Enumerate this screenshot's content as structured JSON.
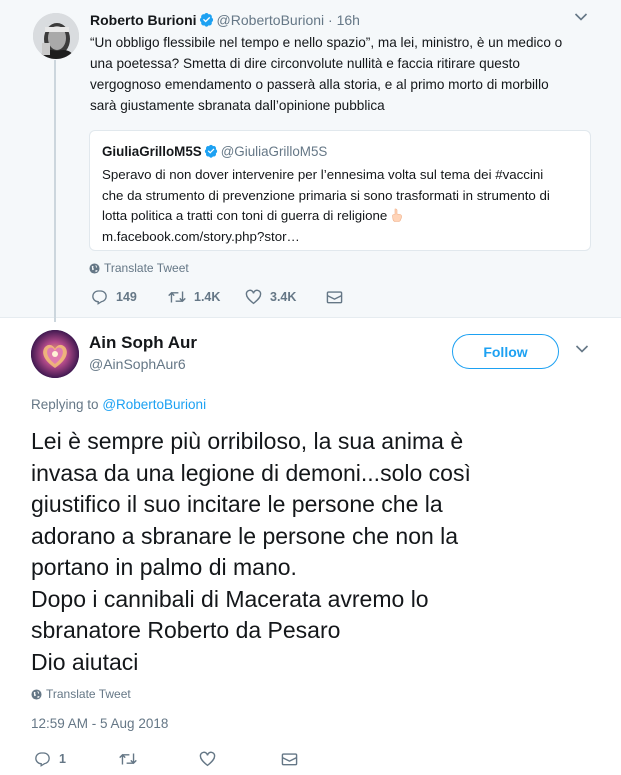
{
  "parent_tweet": {
    "author_name": "Roberto Burioni",
    "author_handle": "@RobertoBurioni",
    "time": "16h",
    "separator": "·",
    "text_lines": [
      "“Un obbligo flessibile nel tempo e nello spazio”, ma lei, ministro, è un medico o",
      "una poetessa? Smetta di dire circonvolute nullità e faccia ritirare questo",
      "vergognoso emendamento o passerà alla storia, e al primo morto di morbillo",
      "sarà giustamente sbranata dall’opinione pubblica"
    ],
    "quoted": {
      "author_name": "GiuliaGrilloM5S",
      "author_handle": "@GiuliaGrilloM5S",
      "text_lines": [
        "Speravo di non dover intervenire per l’ennesima volta sul tema dei #vaccini",
        "che da strumento di prevenzione primaria si sono trasformati in strumento di",
        "lotta politica a tratti con toni di guerra di religione",
        "m.facebook.com/story.php?stor…"
      ]
    },
    "translate_label": "Translate Tweet",
    "actions": {
      "reply_count": "149",
      "retweet_count": "1.4K",
      "like_count": "3.4K"
    }
  },
  "main_tweet": {
    "author_name": "Ain Soph Aur",
    "author_handle": "@AinSophAur6",
    "follow_label": "Follow",
    "replying_label": "Replying to",
    "replying_to": "@RobertoBurioni",
    "text_lines": [
      "Lei è sempre più orribiloso, la sua anima è",
      "invasa da una legione di demoni...solo così",
      "giustifico il suo incitare le persone che la",
      "adorano a sbranare le persone che non la",
      "portano in palmo di mano.",
      "Dopo i cannibali di Macerata avremo lo",
      "sbranatore Roberto da Pesaro",
      "Dio aiutaci"
    ],
    "translate_label": "Translate Tweet",
    "timestamp": "12:59 AM - 5 Aug 2018",
    "actions": {
      "reply_count": "1"
    }
  },
  "colors": {
    "accent": "#1da1f2",
    "secondary_text": "#657786",
    "parent_background": "#f5f8fa",
    "thread_line": "#ccd6dd"
  },
  "icons": [
    "verified-badge-icon",
    "chevron-down-icon",
    "globe-icon",
    "reply-icon",
    "retweet-icon",
    "like-icon",
    "direct-message-icon",
    "pointing-hand-emoji-icon"
  ]
}
